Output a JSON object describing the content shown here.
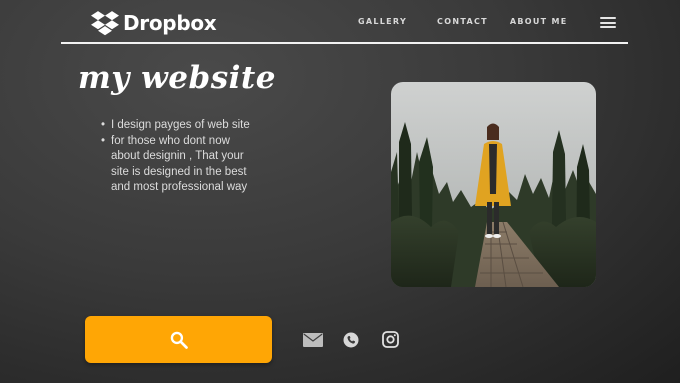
{
  "brand": {
    "name": "Dropbox",
    "logo_icon": "dropbox-icon"
  },
  "nav": {
    "items": [
      {
        "label": "GALLERY"
      },
      {
        "label": "CONTACT"
      },
      {
        "label": "ABOUT ME"
      }
    ],
    "menu_icon": "hamburger-menu-icon"
  },
  "hero": {
    "title": "my website",
    "bullets": [
      "I design payges of web site",
      "for those who dont now about designin , That your site is designed in the best and most professional way"
    ],
    "photo_subject": "woman in yellow raincoat on wooden boardwalk in forest"
  },
  "actions": {
    "search_icon": "search-icon",
    "social_icons": [
      "mail-icon",
      "phone-icon",
      "instagram-icon"
    ]
  },
  "colors": {
    "accent": "#ffa605",
    "background": "#3a3a3a",
    "text": "#e8e8e8"
  }
}
